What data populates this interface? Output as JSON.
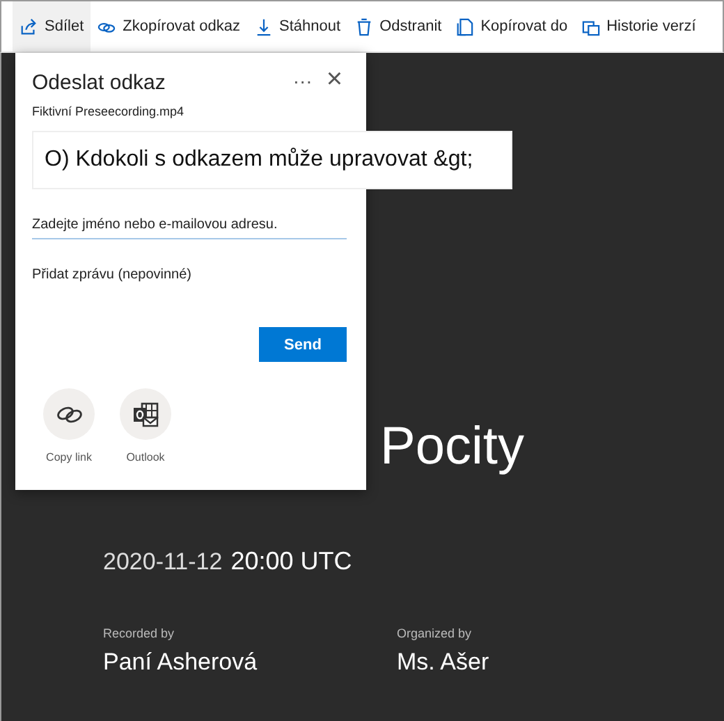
{
  "toolbar": [
    {
      "label": "Sdílet",
      "kind": "share",
      "selected": true
    },
    {
      "label": "Zkopírovat odkaz",
      "kind": "link",
      "selected": false
    },
    {
      "label": "Stáhnout",
      "kind": "download",
      "selected": false
    },
    {
      "label": "Odstranit",
      "kind": "trash",
      "selected": false
    },
    {
      "label": "Kopírovat do",
      "kind": "copy",
      "selected": false
    },
    {
      "label": "Historie verzí",
      "kind": "history",
      "selected": false
    }
  ],
  "dialog": {
    "title": "Odeslat odkaz",
    "more": "···",
    "close": "×",
    "file_name": "Fiktivní Preseecording.mp4",
    "link_settings": "O) Kdokoli s odkazem může upravovat &gt;",
    "recipient": {
      "placeholder": "Zadejte jméno nebo e-mailovou adresu."
    },
    "message": {
      "placeholder": "Přidat zprávu (nepovinné)"
    },
    "send": "Send",
    "share_options": [
      {
        "label": "Copy link",
        "kind": "link"
      },
      {
        "label": "Outlook",
        "kind": "outlook"
      }
    ]
  },
  "meeting": {
    "title": "Pocity",
    "date": "2020-11-12",
    "time": "20:00 UTC",
    "recorded_by_label": "Recorded by",
    "recorded_by": "Paní Asherová",
    "organized_by_label": "Organized by",
    "organized_by": "Ms. Ašer"
  }
}
